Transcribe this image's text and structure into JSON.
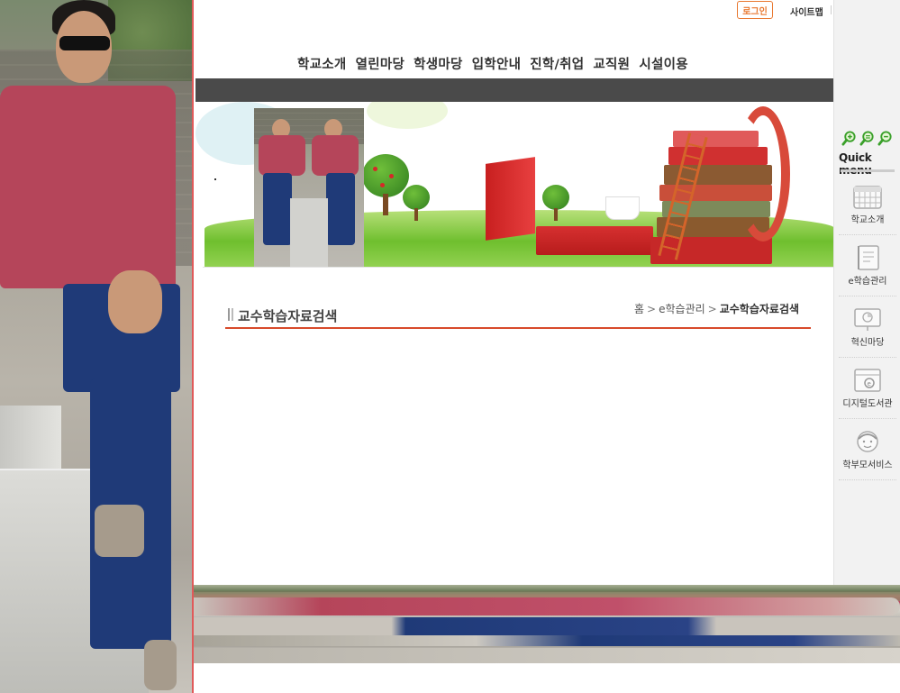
{
  "header": {
    "login_label": "로그인",
    "sitemap_label": "사이트맵"
  },
  "gnb": {
    "items": [
      "학교소개",
      "열린마당",
      "학생마당",
      "입학안내",
      "진학/취업",
      "교직원",
      "시설이용"
    ]
  },
  "content": {
    "title": "교수학습자료검색",
    "breadcrumb": {
      "home": "홈",
      "level1": "e학습관리",
      "current": "교수학습자료검색",
      "separator": ">"
    }
  },
  "quick_menu": {
    "title": "Quick menu",
    "zoom_icons": [
      "zoom-in-icon",
      "zoom-reset-icon",
      "zoom-out-icon"
    ],
    "items": [
      {
        "label": "학교소개",
        "icon": "calendar-icon"
      },
      {
        "label": "e학습관리",
        "icon": "notebook-icon"
      },
      {
        "label": "혁신마당",
        "icon": "presentation-icon"
      },
      {
        "label": "디지털도서관",
        "icon": "library-icon"
      },
      {
        "label": "학부모서비스",
        "icon": "parent-face-icon"
      }
    ]
  },
  "colors": {
    "accent_orange": "#e8772e",
    "nav_bar": "#4a4a4a",
    "title_rule": "#d84a2a",
    "zoom_green": "#3aa02a"
  }
}
